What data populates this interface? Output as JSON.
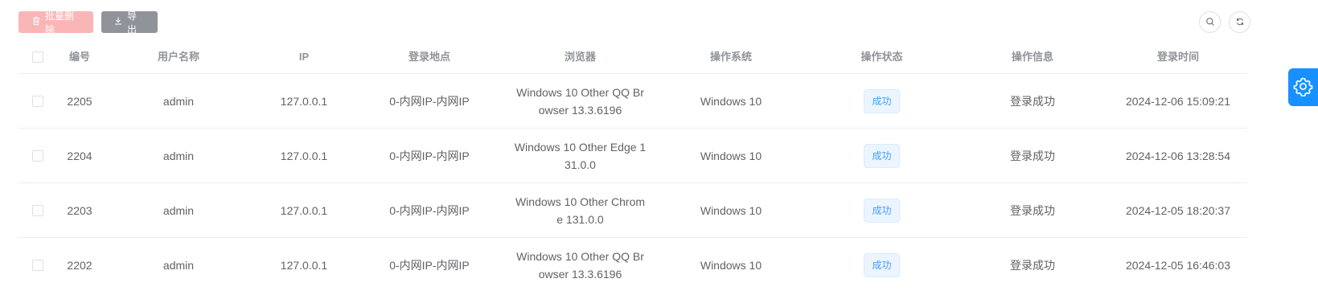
{
  "toolbar": {
    "batch_delete_label": "批量删除",
    "export_label": "导出"
  },
  "table": {
    "headers": {
      "id": "编号",
      "username": "用户名称",
      "ip": "IP",
      "location": "登录地点",
      "browser": "浏览器",
      "os": "操作系统",
      "status": "操作状态",
      "info": "操作信息",
      "time": "登录时间"
    },
    "rows": [
      {
        "id": "2205",
        "username": "admin",
        "ip": "127.0.0.1",
        "location": "0-内网IP-内网IP",
        "browser": "Windows 10 Other QQ Browser 13.3.6196",
        "os": "Windows 10",
        "status": "成功",
        "info": "登录成功",
        "time": "2024-12-06 15:09:21"
      },
      {
        "id": "2204",
        "username": "admin",
        "ip": "127.0.0.1",
        "location": "0-内网IP-内网IP",
        "browser": "Windows 10 Other Edge 131.0.0",
        "os": "Windows 10",
        "status": "成功",
        "info": "登录成功",
        "time": "2024-12-06 13:28:54"
      },
      {
        "id": "2203",
        "username": "admin",
        "ip": "127.0.0.1",
        "location": "0-内网IP-内网IP",
        "browser": "Windows 10 Other Chrome 131.0.0",
        "os": "Windows 10",
        "status": "成功",
        "info": "登录成功",
        "time": "2024-12-05 18:20:37"
      },
      {
        "id": "2202",
        "username": "admin",
        "ip": "127.0.0.1",
        "location": "0-内网IP-内网IP",
        "browser": "Windows 10 Other QQ Browser 13.3.6196",
        "os": "Windows 10",
        "status": "成功",
        "info": "登录成功",
        "time": "2024-12-05 16:46:03"
      }
    ]
  },
  "icons": {
    "delete": "trash-icon",
    "export": "download-icon",
    "search": "search-icon",
    "refresh": "refresh-icon",
    "settings": "gear-icon"
  },
  "colors": {
    "primary": "#1890ff",
    "danger_disabled": "#fab6b6",
    "info": "#909399",
    "tag_text": "#409eff",
    "tag_bg": "#ecf5ff"
  }
}
